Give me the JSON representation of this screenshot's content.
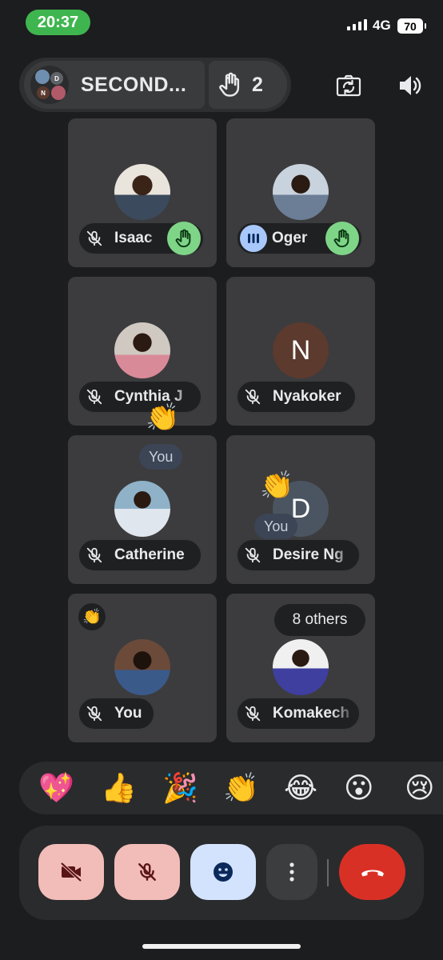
{
  "status_bar": {
    "time": "20:37",
    "network": "4G",
    "battery": "70"
  },
  "header": {
    "meeting_title": "SECOND...",
    "raised_hands_count": "2",
    "cluster_initials": [
      "D",
      "N"
    ]
  },
  "tiles": [
    {
      "name": "Isaac",
      "mic": "muted",
      "hand_raised": true
    },
    {
      "name": "Oger",
      "mic": "speaking",
      "hand_raised": true
    },
    {
      "name": "Cynthia J",
      "mic": "muted"
    },
    {
      "name": "Nyakoker",
      "mic": "muted",
      "initial": "N"
    },
    {
      "name": "Catherine",
      "mic": "muted"
    },
    {
      "name": "Desire Ng",
      "mic": "muted",
      "initial": "D"
    },
    {
      "name": "You",
      "mic": "muted"
    },
    {
      "name": "Komakech",
      "mic": "muted"
    }
  ],
  "floating_reactions": [
    {
      "emoji": "👏",
      "label": "You"
    },
    {
      "emoji": "👏",
      "label": "You"
    }
  ],
  "self_reaction_badge": "👏",
  "others_label": "8 others",
  "reactions": [
    "💖",
    "👍",
    "🎉",
    "👏",
    "😂",
    "😮",
    "😢"
  ],
  "controls": {
    "camera": "off",
    "microphone": "off",
    "reactions": "on",
    "more": "more options",
    "end_call": "leave call"
  },
  "colors": {
    "background": "#1c1d1f",
    "tile": "#3c3c3e",
    "status_green": "#3fb54f",
    "hand_green": "#7fd587",
    "speaking_blue": "#a8c7fa",
    "off_button_pink": "#f2bcb8",
    "reaction_button_blue": "#d3e3fd",
    "end_call_red": "#d93025"
  }
}
